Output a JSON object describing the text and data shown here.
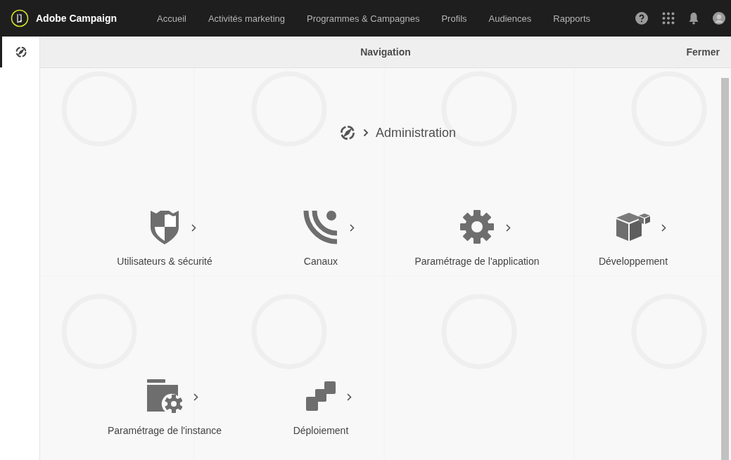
{
  "header": {
    "product": "Adobe Campaign",
    "nav": [
      {
        "label": "Accueil"
      },
      {
        "label": "Activités marketing"
      },
      {
        "label": "Programmes & Campagnes"
      },
      {
        "label": "Profils"
      },
      {
        "label": "Audiences"
      },
      {
        "label": "Rapports"
      }
    ]
  },
  "navigation_bar": {
    "title": "Navigation",
    "close": "Fermer"
  },
  "breadcrumb": {
    "label": "Administration"
  },
  "admin_items": [
    {
      "kind": "shield",
      "label": "Utilisateurs & sécurité"
    },
    {
      "kind": "signal",
      "label": "Canaux"
    },
    {
      "kind": "gear",
      "label": "Paramétrage de l'application"
    },
    {
      "kind": "cube",
      "label": "Développement"
    },
    {
      "kind": "folder",
      "label": "Paramétrage de l'instance"
    },
    {
      "kind": "stack",
      "label": "Déploiement"
    }
  ]
}
